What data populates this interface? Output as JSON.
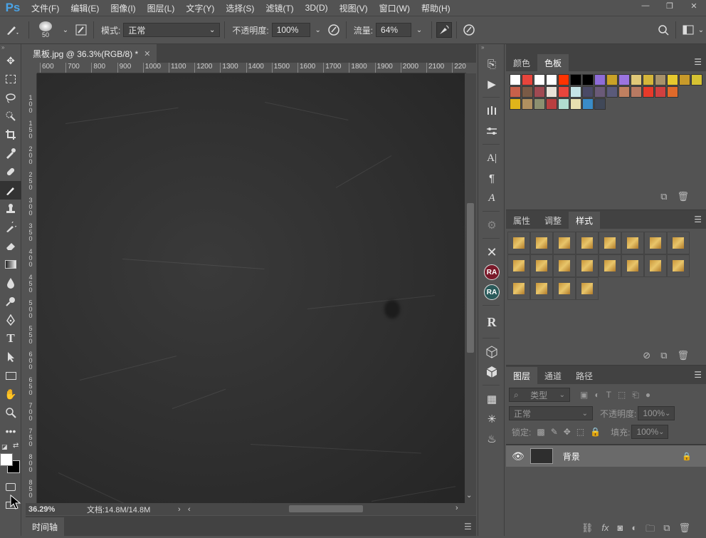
{
  "app": {
    "logo": "Ps"
  },
  "menu": [
    "文件(F)",
    "编辑(E)",
    "图像(I)",
    "图层(L)",
    "文字(Y)",
    "选择(S)",
    "滤镜(T)",
    "3D(D)",
    "视图(V)",
    "窗口(W)",
    "帮助(H)"
  ],
  "window_controls": {
    "minimize": "—",
    "restore": "❐",
    "close": "✕"
  },
  "options": {
    "brush_size": "50",
    "mode_label": "模式:",
    "mode_value": "正常",
    "opacity_label": "不透明度:",
    "opacity_value": "100%",
    "flow_label": "流量:",
    "flow_value": "64%"
  },
  "document": {
    "tab_title": "黑板.jpg @ 36.3%(RGB/8) *",
    "zoom": "36.29%",
    "doc_info": "文档:14.8M/14.8M"
  },
  "ruler_top": [
    "600",
    "700",
    "800",
    "900",
    "1000",
    "1100",
    "1200",
    "1300",
    "1400",
    "1500",
    "1600",
    "1700",
    "1800",
    "1900",
    "2000",
    "2100",
    "220"
  ],
  "ruler_left": [
    "1 0 0",
    "1 5 0",
    "2 0 0",
    "2 5 0",
    "3 0 0",
    "3 5 0",
    "4 0 0",
    "4 5 0",
    "5 0 0",
    "5 5 0",
    "6 0 0",
    "6 5 0",
    "7 0 0",
    "7 5 0",
    "8 0 0",
    "8 5 0"
  ],
  "timeline": {
    "tab": "时间轴"
  },
  "color_panel": {
    "tabs": [
      "颜色",
      "色板"
    ]
  },
  "swatches": [
    [
      "#ffffff",
      "#e8453c",
      "#ffffff",
      "#ffffff",
      "#ff3300",
      "#000000",
      "#000000",
      "#8e6cd8",
      "#c9a227",
      "#9b74e0",
      "#e0c878",
      "#d4b53a",
      "#a8926a",
      "#e6c92e",
      "#c89a2a",
      "#d6c232"
    ],
    [
      "#c8604a",
      "#7a5a46",
      "#a04a52",
      "#e8e2d8",
      "#e8453c",
      "#c5e3e6",
      "#4a4a66",
      "#6a5a78",
      "#5a5a7a",
      "#c08060",
      "#b87a62",
      "#e83a2a",
      "#d04040",
      "#e06a2a"
    ],
    [
      "#e0b41a",
      "#b09060",
      "#8c9070",
      "#b84040",
      "#b0dcd0",
      "#e8e0b0",
      "#3a8cc8",
      "#404858"
    ]
  ],
  "props_panel": {
    "tabs": [
      "属性",
      "调整",
      "样式"
    ]
  },
  "layers_panel": {
    "tabs": [
      "图层",
      "通道",
      "路径"
    ],
    "filter": "类型",
    "blend": "正常",
    "opacity_label": "不透明度:",
    "opacity_value": "100%",
    "lock_label": "锁定:",
    "fill_label": "填充:",
    "fill_value": "100%",
    "layer_name": "背景"
  }
}
